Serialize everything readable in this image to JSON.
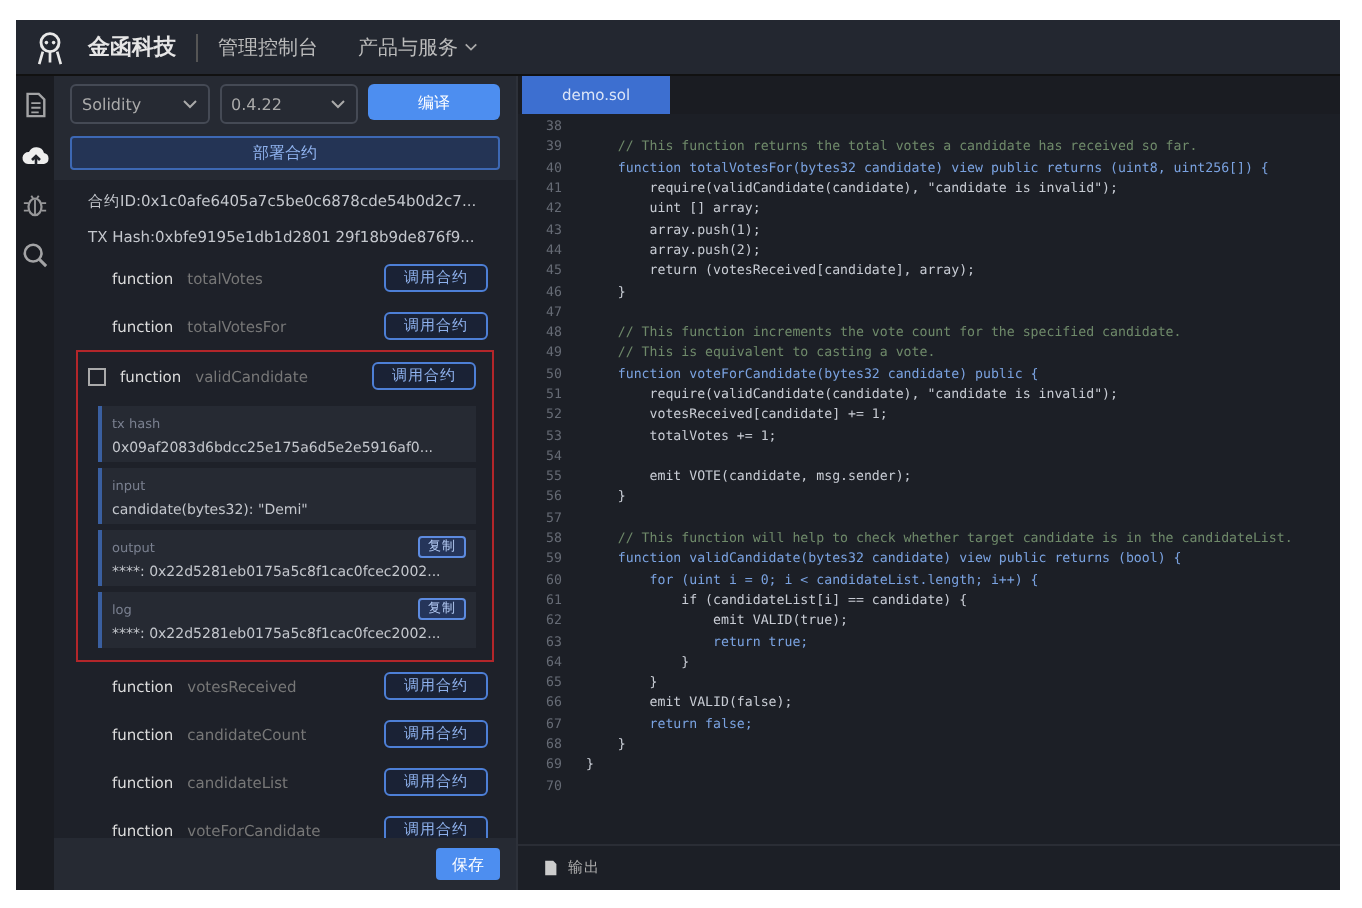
{
  "header": {
    "logo_text": "金函科技",
    "nav": [
      {
        "label": "管理控制台",
        "dropdown": false
      },
      {
        "label": "产品与服务",
        "dropdown": true
      }
    ]
  },
  "sidebar_icons": [
    {
      "kind": "file",
      "selected": false
    },
    {
      "kind": "cloud",
      "selected": true
    },
    {
      "kind": "bug",
      "selected": false
    },
    {
      "kind": "search",
      "selected": false
    }
  ],
  "panel": {
    "language": "Solidity",
    "version": "0.4.22",
    "compile_button": "编译",
    "deploy_button": "部署合约",
    "contract_id": "合约ID:0x1c0afe6405a7c5be0c6878cde54b0d2c7...",
    "tx_hash": "TX Hash:0xbfe9195e1db1d2801 29f18b9de876f9...",
    "functions": [
      {
        "label": "function",
        "name": "totalVotes",
        "button": "调用合约",
        "expanded": false
      },
      {
        "label": "function",
        "name": "totalVotesFor",
        "button": "调用合约",
        "expanded": false
      },
      {
        "label": "function",
        "name": "validCandidate",
        "button": "调用合约",
        "expanded": true,
        "details": [
          {
            "label": "tx hash",
            "value": "0x09af2083d6bdcc25e175a6d5e2e5916af0..."
          },
          {
            "label": "input",
            "value": "candidate(bytes32): \"Demi\""
          },
          {
            "label": "output",
            "value": "****: 0x22d5281eb0175a5c8f1cac0fcec2002...",
            "button": "复制"
          },
          {
            "label": "log",
            "value": "****: 0x22d5281eb0175a5c8f1cac0fcec2002...",
            "button": "复制"
          }
        ]
      },
      {
        "label": "function",
        "name": "votesReceived",
        "button": "调用合约",
        "expanded": false
      },
      {
        "label": "function",
        "name": "candidateCount",
        "button": "调用合约",
        "expanded": false
      },
      {
        "label": "function",
        "name": "candidateList",
        "button": "调用合约",
        "expanded": false
      },
      {
        "label": "function",
        "name": "voteForCandidate",
        "button": "调用合约",
        "expanded": false
      }
    ],
    "save_button": "保存"
  },
  "editor": {
    "tabs": [
      {
        "label": "demo.sol",
        "selected": true
      }
    ],
    "lines": [
      {
        "n": "38"
      },
      {
        "n": "39",
        "kind": "comment",
        "text": "    // This function returns the total votes a candidate has received so far."
      },
      {
        "n": "40",
        "kind": "keyword",
        "text": "    function totalVotesFor(bytes32 candidate) view public returns (uint8, uint256[]) {"
      },
      {
        "n": "41",
        "kind": "code",
        "text": "        require(validCandidate(candidate), \"candidate is invalid\");"
      },
      {
        "n": "42",
        "kind": "code",
        "text": "        uint [] array;"
      },
      {
        "n": "43",
        "kind": "code",
        "text": "        array.push(1);"
      },
      {
        "n": "44",
        "kind": "code",
        "text": "        array.push(2);"
      },
      {
        "n": "45",
        "kind": "code",
        "text": "        return (votesReceived[candidate], array);"
      },
      {
        "n": "46",
        "kind": "code",
        "text": "    }"
      },
      {
        "n": "47"
      },
      {
        "n": "48",
        "kind": "comment",
        "text": "    // This function increments the vote count for the specified candidate."
      },
      {
        "n": "49",
        "kind": "comment",
        "text": "    // This is equivalent to casting a vote."
      },
      {
        "n": "50",
        "kind": "keyword",
        "text": "    function voteForCandidate(bytes32 candidate) public {"
      },
      {
        "n": "51",
        "kind": "code",
        "text": "        require(validCandidate(candidate), \"candidate is invalid\");"
      },
      {
        "n": "52",
        "kind": "code",
        "text": "        votesReceived[candidate] += 1;"
      },
      {
        "n": "53",
        "kind": "code",
        "text": "        totalVotes += 1;"
      },
      {
        "n": "54"
      },
      {
        "n": "55",
        "kind": "code",
        "text": "        emit VOTE(candidate, msg.sender);"
      },
      {
        "n": "56",
        "kind": "code",
        "text": "    }"
      },
      {
        "n": "57"
      },
      {
        "n": "58",
        "kind": "comment",
        "text": "    // This function will help to check whether target candidate is in the candidateList."
      },
      {
        "n": "59",
        "kind": "keyword",
        "text": "    function validCandidate(bytes32 candidate) view public returns (bool) {"
      },
      {
        "n": "60",
        "kind": "keyword",
        "text": "        for (uint i = 0; i < candidateList.length; i++) {"
      },
      {
        "n": "61",
        "kind": "code",
        "text": "            if (candidateList[i] == candidate) {"
      },
      {
        "n": "62",
        "kind": "code",
        "text": "                emit VALID(true);"
      },
      {
        "n": "63",
        "kind": "keyword",
        "text": "                return true;"
      },
      {
        "n": "64",
        "kind": "code",
        "text": "            }"
      },
      {
        "n": "65",
        "kind": "code",
        "text": "        }"
      },
      {
        "n": "66",
        "kind": "code",
        "text": "        emit VALID(false);"
      },
      {
        "n": "67",
        "kind": "keyword",
        "text": "        return false;"
      },
      {
        "n": "68",
        "kind": "code",
        "text": "    }"
      },
      {
        "n": "69",
        "kind": "code",
        "text": "}"
      },
      {
        "n": "70"
      }
    ]
  },
  "output_bar": {
    "label": "输出"
  }
}
